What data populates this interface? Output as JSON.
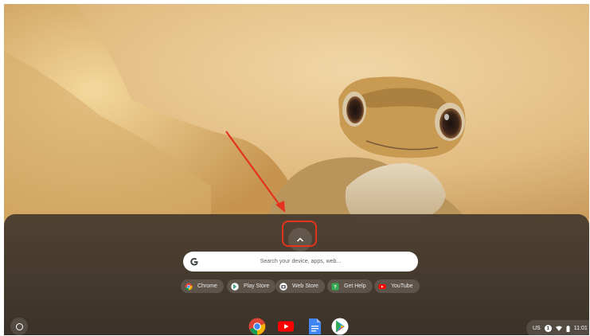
{
  "launcher": {
    "search_placeholder": "Search your device, apps, web...",
    "suggestions": [
      {
        "label": "Chrome",
        "icon": "chrome-icon"
      },
      {
        "label": "Play Store",
        "icon": "play-store-icon"
      },
      {
        "label": "Web Store",
        "icon": "web-store-icon"
      },
      {
        "label": "Get Help",
        "icon": "get-help-icon"
      },
      {
        "label": "YouTube",
        "icon": "youtube-icon"
      }
    ]
  },
  "shelf": {
    "apps": [
      "chrome-icon",
      "youtube-icon",
      "google-docs-icon",
      "play-store-icon"
    ]
  },
  "tray": {
    "input_method": "US",
    "notification_count": "1",
    "time": "11:01"
  },
  "colors": {
    "annotation_red": "#e4321e",
    "sand": "#d9b27a"
  }
}
